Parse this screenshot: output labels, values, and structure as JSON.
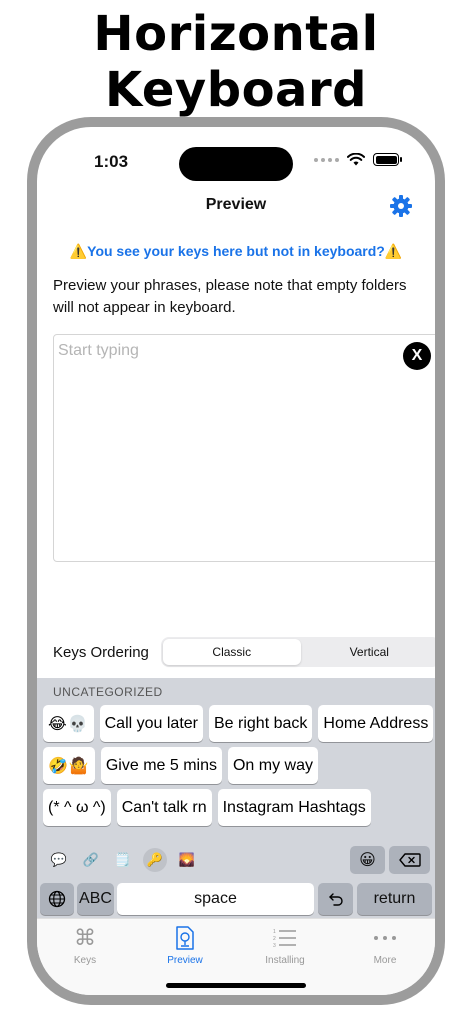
{
  "headline": {
    "line1": "Horizontal",
    "line2": "Keyboard"
  },
  "status": {
    "time": "1:03"
  },
  "nav": {
    "title": "Preview",
    "settings_icon": "gear-icon"
  },
  "warning": {
    "icon": "warning-icon",
    "text": "You see your keys here but not in keyboard?"
  },
  "description": "Preview your phrases, please note that empty folders will not appear in keyboard.",
  "input": {
    "placeholder": "Start typing",
    "value": "",
    "clear_label": "X"
  },
  "ordering": {
    "label": "Keys Ordering",
    "options": [
      "Classic",
      "Vertical"
    ],
    "selected": "Classic"
  },
  "keyboard": {
    "section": "UNCATEGORIZED",
    "rows": [
      [
        "😂💀",
        "Call you later",
        "Be right back",
        "Home Address"
      ],
      [
        "🤣🤷",
        "Give me 5 mins",
        "On my way"
      ],
      [
        "(* ^ ω ^)",
        "Can't talk rn",
        "Instagram Hashtags"
      ]
    ],
    "tools": [
      "speech-bubble-icon",
      "link-icon",
      "box-icon",
      "key-icon",
      "image-icon"
    ],
    "emoji_key": "😀",
    "abc_label": "ABC",
    "space_label": "space",
    "return_label": "return"
  },
  "tabs": [
    {
      "label": "Keys",
      "icon": "command-icon",
      "active": false
    },
    {
      "label": "Preview",
      "icon": "preview-icon",
      "active": true
    },
    {
      "label": "Installing",
      "icon": "list-icon",
      "active": false
    },
    {
      "label": "More",
      "icon": "more-icon",
      "active": false
    }
  ],
  "colors": {
    "accent": "#1a73e8",
    "frame": "#9c9c9c",
    "keyboard_bg": "#d2d5db"
  }
}
